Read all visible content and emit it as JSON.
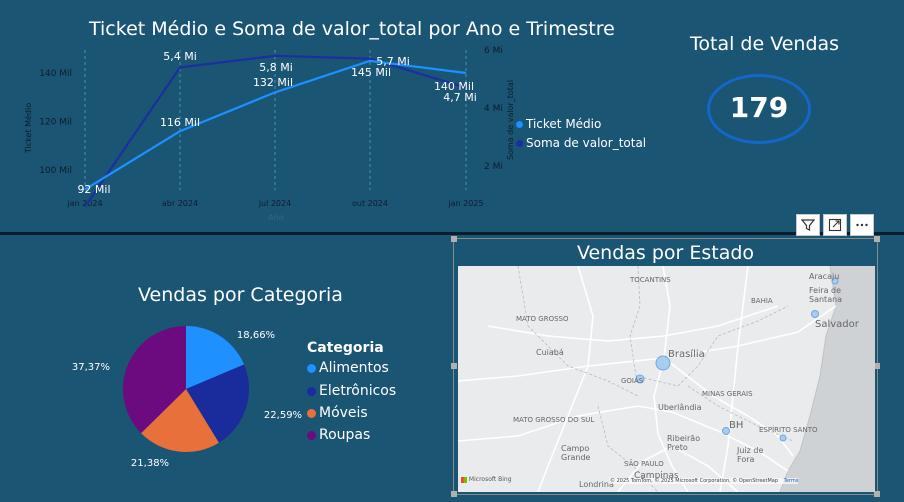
{
  "line_chart": {
    "title": "Ticket Médio e Soma de valor_total por Ano e Trimestre",
    "y_left_label": "Ticket Médio",
    "y_right_label": "Soma de valor_total",
    "x_label": "Ano",
    "y_left_ticks": [
      "100 Mil",
      "120 Mil",
      "140 Mil"
    ],
    "y_right_ticks": [
      "2 Mi",
      "4 Mi",
      "6 Mi"
    ],
    "legend": [
      "Ticket Médio",
      "Soma de valor_total"
    ],
    "colors": {
      "ticket": "#1e90ff",
      "soma": "#1a2fa0"
    }
  },
  "kpi": {
    "title": "Total de Vendas",
    "value": "179"
  },
  "pie": {
    "title": "Vendas por Categoria",
    "legend_title": "Categoria"
  },
  "map": {
    "title": "Vendas por Estado",
    "labels": [
      "TOCANTINS",
      "BAHIA",
      "MATO GROSSO",
      "Salvador",
      "Brasília",
      "Cuiabá",
      "GOIÁS",
      "MINAS GERAIS",
      "Uberlândia",
      "MATO GROSSO DO SUL",
      "BH",
      "ESPÍRITO SANTO",
      "Campo Grande",
      "Ribeirão Preto",
      "Juiz de Fora",
      "SÃO PAULO",
      "Campinas",
      "Londrina",
      "Aracaju",
      "Feira de Santana"
    ],
    "attribution": "© 2025 TomTom, © 2025 Microsoft Corporation, © OpenStreetMap",
    "terms": "Terms",
    "logo": "Microsoft Bing"
  },
  "chart_data": [
    {
      "type": "line",
      "title": "Ticket Médio e Soma de valor_total por Ano e Trimestre",
      "xlabel": "Ano",
      "ylabel": "Ticket Médio",
      "y2label": "Soma de valor_total",
      "categories": [
        "jan 2024",
        "abr 2024",
        "jul 2024",
        "out 2024",
        "jan 2025"
      ],
      "series": [
        {
          "name": "Ticket Médio",
          "axis": "left",
          "values": [
            92000,
            116000,
            132000,
            145000,
            140000
          ],
          "labels": [
            "92 Mil",
            "116 Mil",
            "132 Mil",
            "145 Mil",
            "140 Mil"
          ]
        },
        {
          "name": "Soma de valor_total",
          "axis": "right",
          "values": [
            0.6,
            5.4,
            5.8,
            5.7,
            4.7
          ],
          "labels": [
            "",
            "5,4 Mi",
            "5,8 Mi",
            "5,7 Mi",
            "4,7 Mi"
          ]
        }
      ],
      "ylim": [
        95000,
        150000
      ],
      "y2lim": [
        0,
        6
      ]
    },
    {
      "type": "pie",
      "title": "Vendas por Categoria",
      "legend_title": "Categoria",
      "categories": [
        "Alimentos",
        "Eletrônicos",
        "Móveis",
        "Roupas"
      ],
      "values": [
        18.66,
        22.59,
        21.38,
        37.37
      ],
      "labels": [
        "18,66%",
        "22,59%",
        "21,38%",
        "37,37%"
      ],
      "colors": [
        "#1e90ff",
        "#1a2c9c",
        "#e8703a",
        "#6c0a80"
      ]
    }
  ]
}
